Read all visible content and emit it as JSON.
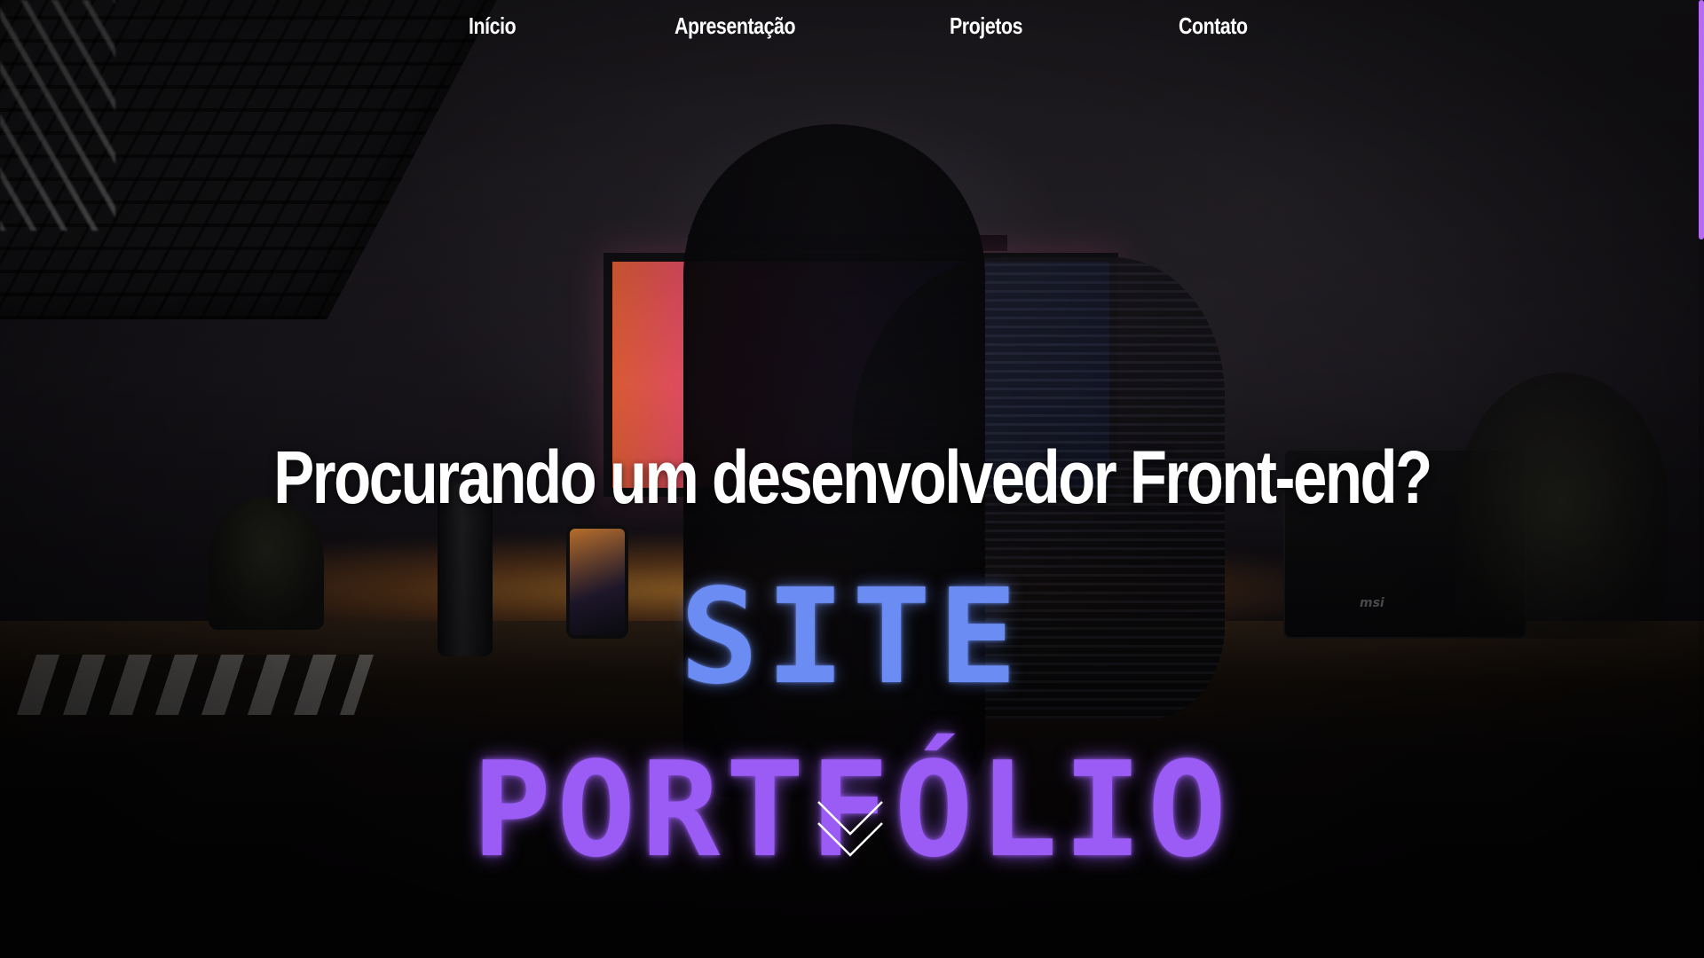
{
  "nav": {
    "items": [
      {
        "label": "Início"
      },
      {
        "label": "Apresentação"
      },
      {
        "label": "Projetos"
      },
      {
        "label": "Contato"
      }
    ]
  },
  "hero": {
    "headline": "Procurando um desenvolvedor Front-end?",
    "title_line1": "SITE",
    "title_line2": "PORTFÓLIO",
    "scroll_icon": "chevron-down-icon"
  },
  "colors": {
    "title_line1": "#6b8cf2",
    "title_line2": "#9b5cf5",
    "scrollbar_thumb": "#b56cf0"
  },
  "background": {
    "laptop_brand": "msi"
  }
}
